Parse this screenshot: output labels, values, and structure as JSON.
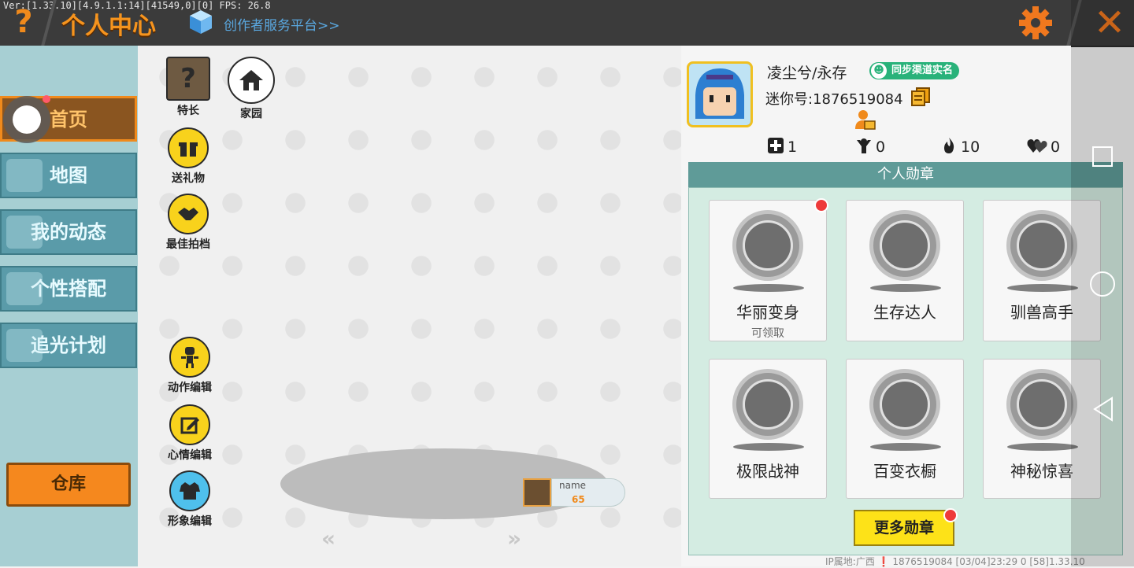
{
  "debug_text": "Ver:[1.33.10][4.9.1.1:14][41549,0][0] FPS: 26.8",
  "header": {
    "help_label": "?",
    "title": "个人中心",
    "creator_link": "创作者服务平台>>",
    "close_label": "✕"
  },
  "sidebar": {
    "items": [
      {
        "label": "首页"
      },
      {
        "label": "地图"
      },
      {
        "label": "我的动态"
      },
      {
        "label": "个性搭配"
      },
      {
        "label": "追光计划"
      }
    ],
    "warehouse": "仓库"
  },
  "actions": {
    "talent": "特长",
    "home": "家园",
    "gift": "送礼物",
    "partner": "最佳拍档",
    "motion_edit": "动作编辑",
    "mood_edit": "心情编辑",
    "image_edit": "形象编辑"
  },
  "character": {
    "name": "name",
    "level": "65",
    "arrow_left": "«",
    "arrow_right": "»"
  },
  "profile": {
    "username": "凌尘兮/永存",
    "sync_badge": "同步渠道实名",
    "mini_id": "迷你号:1876519084",
    "stats": {
      "add": "1",
      "likes": "0",
      "heat": "10",
      "hearts": "0"
    }
  },
  "badges": {
    "header": "个人勋章",
    "items": [
      {
        "name": "华丽变身",
        "sub": "可领取"
      },
      {
        "name": "生存达人",
        "sub": ""
      },
      {
        "name": "驯兽高手",
        "sub": ""
      },
      {
        "name": "极限战神",
        "sub": ""
      },
      {
        "name": "百变衣橱",
        "sub": ""
      },
      {
        "name": "神秘惊喜",
        "sub": ""
      }
    ],
    "more": "更多勋章"
  },
  "footer": "IP属地:广西 ❗  1876519084  [03/04]23:29 0  [58]1.33.10",
  "colors": {
    "orange": "#f6941e",
    "sidebar_teal": "#5a9ba9",
    "badge_green": "#29b27a",
    "yellow": "#fde218",
    "red_dot": "#ee3a3a"
  }
}
